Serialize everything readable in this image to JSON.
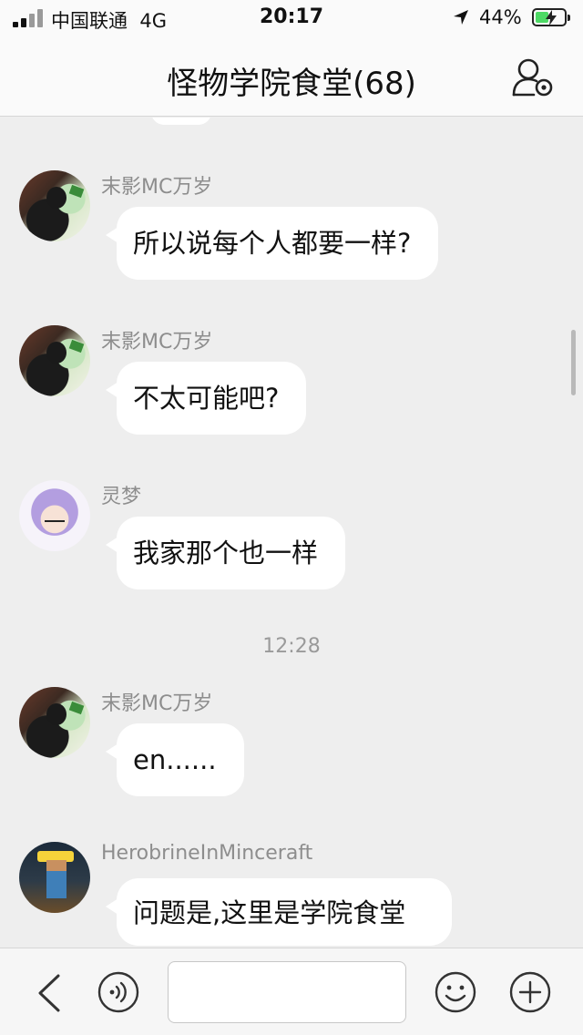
{
  "status_bar": {
    "carrier": "中国联通",
    "network": "4G",
    "time": "20:17",
    "battery_percent": "44%",
    "battery_level": 0.44,
    "icons": [
      "signal-icon",
      "location-arrow-icon",
      "battery-charging-icon"
    ]
  },
  "header": {
    "title": "怪物学院食堂(68)",
    "right_icon": "group-settings-icon"
  },
  "messages": [
    {
      "sender": "末影MC万岁",
      "text": "所以说每个人都要一样?",
      "avatar": "avatar-endermc"
    },
    {
      "sender": "末影MC万岁",
      "text": "不太可能吧?",
      "avatar": "avatar-endermc"
    },
    {
      "sender": "灵梦",
      "text": "我家那个也一样",
      "avatar": "avatar-reimu"
    },
    {
      "sender": "末影MC万岁",
      "text": "en......",
      "avatar": "avatar-endermc"
    },
    {
      "sender": "HerobrineInMinceraft",
      "text": "问题是,这里是学院食堂",
      "avatar": "avatar-herobrine"
    }
  ],
  "time_divider": "12:28",
  "input_bar": {
    "placeholder": "",
    "icons": [
      "back-chevron-icon",
      "voice-icon",
      "emoji-icon",
      "plus-icon"
    ]
  },
  "colors": {
    "background": "#eeeeee",
    "bubble": "#ffffff",
    "sender_name": "#8d8d8d",
    "battery_fill": "#4cd964"
  }
}
